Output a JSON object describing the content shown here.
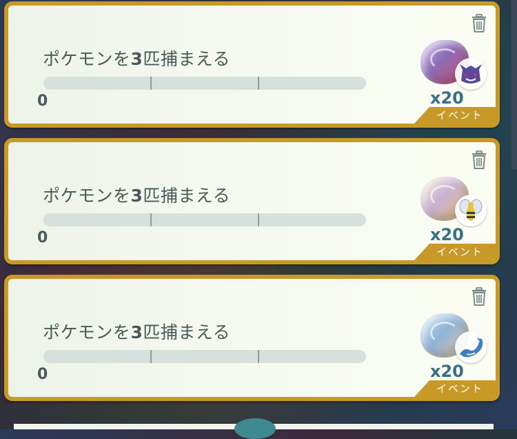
{
  "quests": [
    {
      "title_prefix": "ポケモンを",
      "title_number": "3",
      "title_suffix": "匹捕まえる",
      "progress_value": "0",
      "progress_fraction": 0,
      "reward_quantity": "x20",
      "reward_item_icon": "evolution-stone-icon",
      "reward_pokemon_icon": "gengar-icon",
      "tag": "イベント",
      "delete_icon": "trash-icon"
    },
    {
      "title_prefix": "ポケモンを",
      "title_number": "3",
      "title_suffix": "匹捕まえる",
      "progress_value": "0",
      "progress_fraction": 0,
      "reward_quantity": "x20",
      "reward_item_icon": "evolution-stone-icon",
      "reward_pokemon_icon": "beedrill-icon",
      "tag": "イベント",
      "delete_icon": "trash-icon"
    },
    {
      "title_prefix": "ポケモンを",
      "title_number": "3",
      "title_suffix": "匹捕まえる",
      "progress_value": "0",
      "progress_fraction": 0,
      "reward_quantity": "x20",
      "reward_item_icon": "evolution-stone-icon",
      "reward_pokemon_icon": "gyarados-icon",
      "tag": "イベント",
      "delete_icon": "trash-icon"
    }
  ],
  "colors": {
    "card_border": "#c79a28",
    "text": "#4a5a5a",
    "quantity": "#3b6f84",
    "progress_track": "#d6e0dc"
  }
}
